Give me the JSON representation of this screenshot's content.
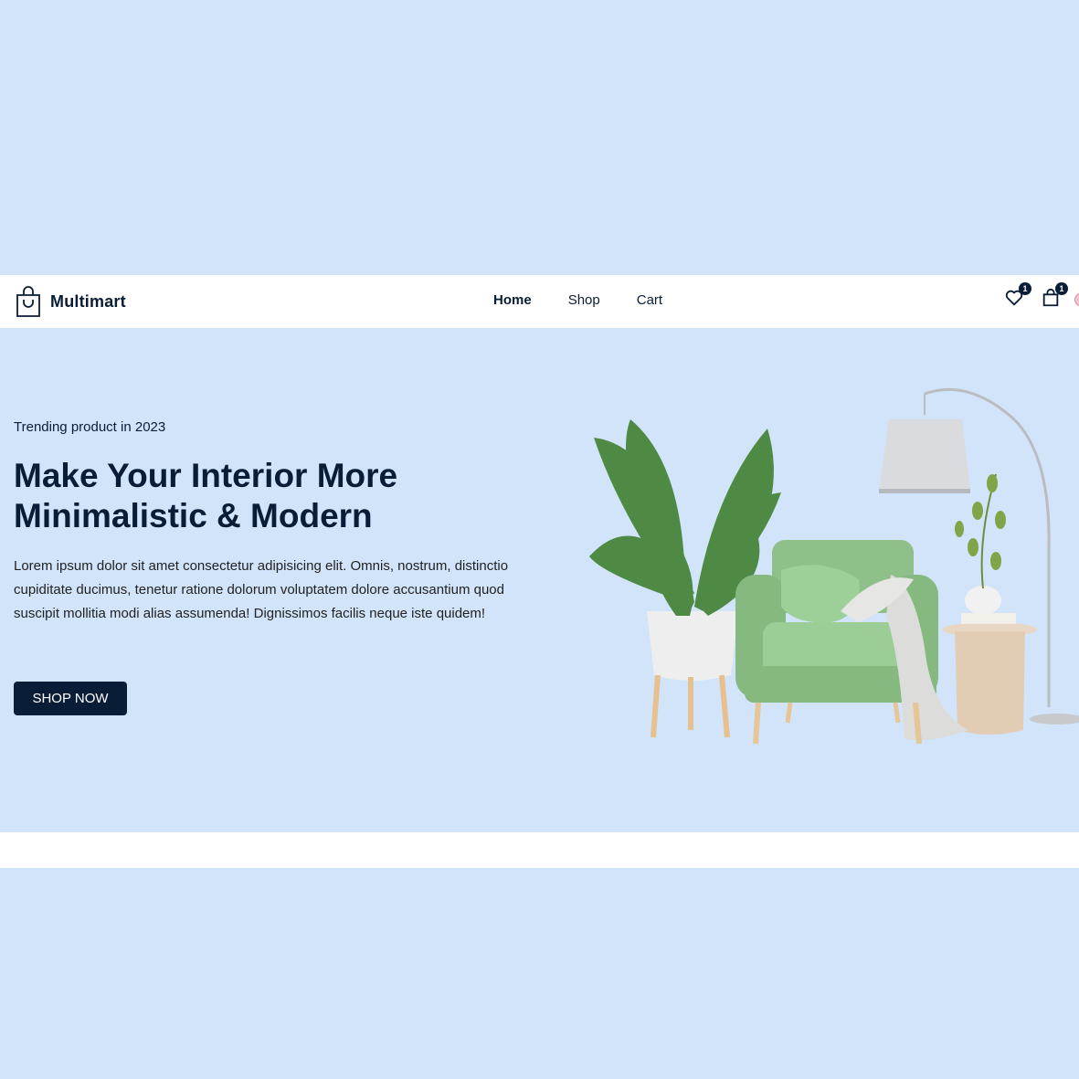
{
  "brand": {
    "name": "Multimart",
    "logo_icon": "shopping-bag-icon"
  },
  "nav": {
    "items": [
      {
        "label": "Home",
        "active": true
      },
      {
        "label": "Shop",
        "active": false
      },
      {
        "label": "Cart",
        "active": false
      }
    ]
  },
  "header_actions": {
    "wishlist": {
      "icon": "heart-icon",
      "count": "1"
    },
    "cart": {
      "icon": "cart-bag-icon",
      "count": "1"
    },
    "avatar": {
      "icon": "user-avatar-icon"
    }
  },
  "hero": {
    "subtitle": "Trending product in 2023",
    "headline": "Make Your Interior More Minimalistic & Modern",
    "description": "Lorem ipsum dolor sit amet consectetur adipisicing elit. Omnis, nostrum, distinctio cupiditate ducimus, tenetur ratione dolorum voluptatem dolore accusantium quod suscipit mollitia modi alias assumenda! Dignissimos facilis neque iste quidem!",
    "cta_label": "SHOP NOW",
    "image": "armchair-plant-lamp-image"
  },
  "colors": {
    "primary": "#0a1d37",
    "hero_bg": "#d1e4fa",
    "white": "#ffffff",
    "chair_green": "#8fc08a"
  }
}
